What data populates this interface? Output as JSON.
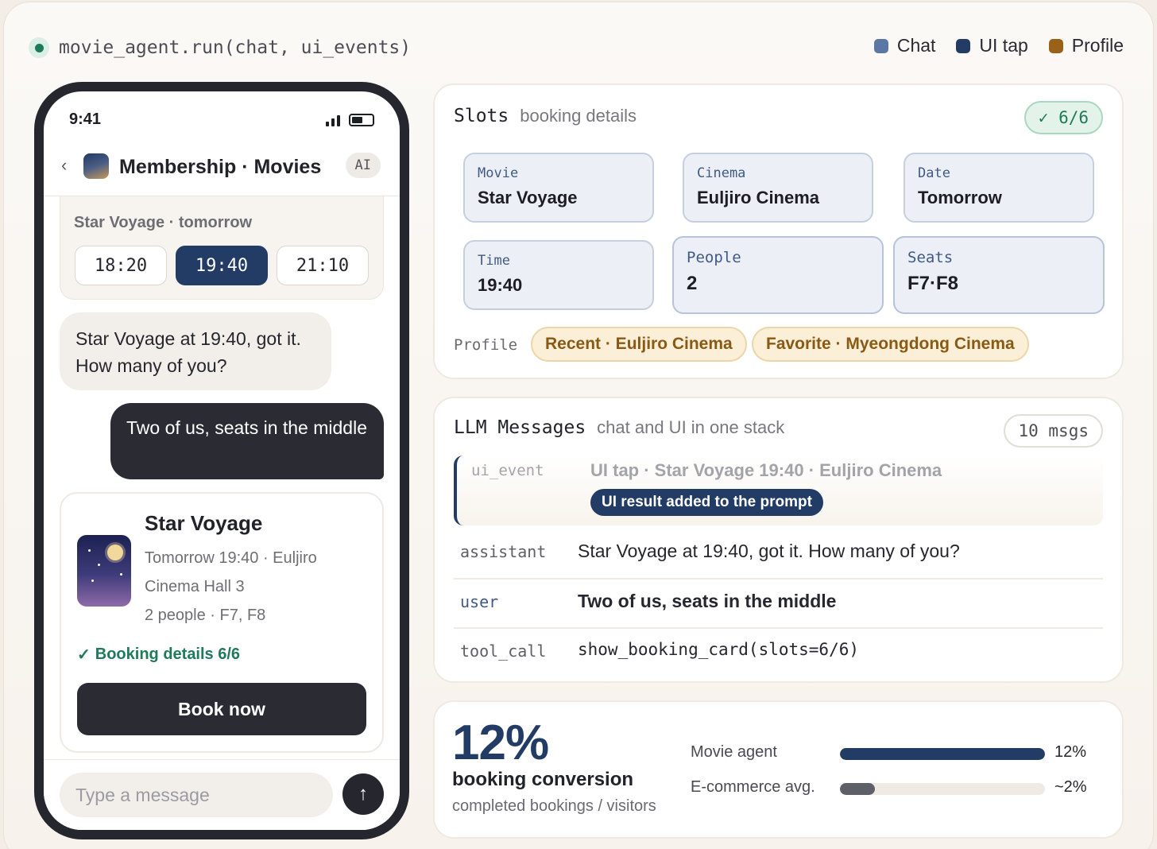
{
  "header": {
    "call": "movie_agent.run(chat, ui_events)",
    "legend": [
      {
        "label": "Chat",
        "color": "#5a77a5"
      },
      {
        "label": "UI tap",
        "color": "#233c66"
      },
      {
        "label": "Profile",
        "color": "#9a6218"
      }
    ]
  },
  "phone": {
    "time": "9:41",
    "app_title": "Membership · Movies",
    "ai_badge": "AI",
    "showtime_card": {
      "title": "Star Voyage · tomorrow",
      "options": [
        "18:20",
        "19:40",
        "21:10"
      ],
      "selected": "19:40"
    },
    "bot_message": "Star Voyage at 19:40, got it. How many of you?",
    "user_message": "Two of us, seats in the middle",
    "booking": {
      "title": "Star Voyage",
      "line1": "Tomorrow 19:40 · Euljiro",
      "line2": "Cinema Hall 3",
      "line3": "2 people · F7, F8",
      "check": "Booking details 6/6",
      "button": "Book now"
    },
    "input_placeholder": "Type a message"
  },
  "slots": {
    "title": "Slots",
    "subtitle": "booking details",
    "badge": "✓ 6/6",
    "items": [
      {
        "label": "Movie",
        "value": "Star Voyage"
      },
      {
        "label": "Cinema",
        "value": "Euljiro Cinema"
      },
      {
        "label": "Date",
        "value": "Tomorrow"
      },
      {
        "label": "Time",
        "value": "19:40"
      },
      {
        "label": "People",
        "value": "2"
      },
      {
        "label": "Seats",
        "value": "F7·F8"
      }
    ],
    "profile_label": "Profile",
    "profile_tags": [
      "Recent · Euljiro Cinema",
      "Favorite · Myeongdong Cinema"
    ]
  },
  "messages": {
    "title": "LLM Messages",
    "subtitle": "chat and UI in one stack",
    "badge": "10 msgs",
    "event": {
      "role": "ui_event",
      "text": "UI tap · Star Voyage 19:40 · Euljiro Cinema",
      "tag": "UI result added to the prompt"
    },
    "rows": [
      {
        "role": "assistant",
        "text": "Star Voyage at 19:40, got it. How many of you?"
      },
      {
        "role": "user",
        "text": "Two of us, seats in the middle"
      },
      {
        "role": "tool_call",
        "text": "show_booking_card(slots=6/6)"
      }
    ]
  },
  "metric": {
    "value": "12%",
    "label": "booking conversion",
    "sub": "completed bookings / visitors",
    "bars": [
      {
        "name": "Movie agent",
        "value_label": "12%",
        "fraction": 1.0,
        "color": "#233c66"
      },
      {
        "name": "E-commerce avg.",
        "value_label": "~2%",
        "fraction": 0.17,
        "color": "#5e6068"
      }
    ]
  }
}
